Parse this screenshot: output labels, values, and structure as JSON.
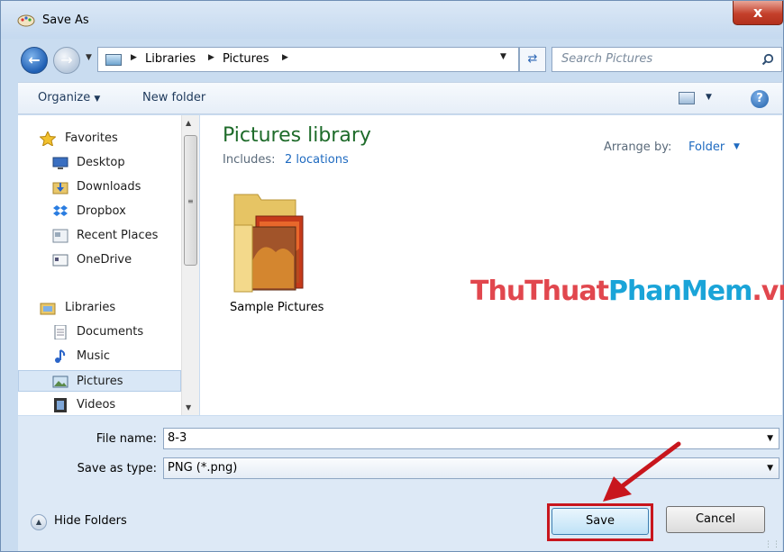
{
  "window": {
    "title": "Save As",
    "close_label": "x"
  },
  "address": {
    "crumbs": [
      "Libraries",
      "Pictures"
    ],
    "search_placeholder": "Search Pictures"
  },
  "toolbar": {
    "organize": "Organize",
    "new_folder": "New folder"
  },
  "nav": {
    "favorites_header": "Favorites",
    "favorites": [
      {
        "label": "Desktop",
        "icon": "desktop-icon"
      },
      {
        "label": "Downloads",
        "icon": "downloads-icon"
      },
      {
        "label": "Dropbox",
        "icon": "dropbox-icon"
      },
      {
        "label": "Recent Places",
        "icon": "recent-places-icon"
      },
      {
        "label": "OneDrive",
        "icon": "onedrive-icon"
      }
    ],
    "libraries_header": "Libraries",
    "libraries": [
      {
        "label": "Documents",
        "icon": "documents-icon"
      },
      {
        "label": "Music",
        "icon": "music-icon"
      },
      {
        "label": "Pictures",
        "icon": "pictures-icon",
        "selected": true
      },
      {
        "label": "Videos",
        "icon": "videos-icon"
      }
    ]
  },
  "content": {
    "library_title": "Pictures library",
    "includes_label": "Includes:",
    "locations_link": "2 locations",
    "arrange_label": "Arrange by:",
    "arrange_value": "Folder",
    "items": [
      {
        "label": "Sample Pictures",
        "icon": "folder-icon"
      }
    ],
    "watermark_a": "ThuThuat",
    "watermark_b": "PhanMem",
    "watermark_c": ".vn"
  },
  "form": {
    "file_name_label": "File name:",
    "file_name_value": "8-3",
    "save_type_label": "Save as type:",
    "save_type_value": "PNG (*.png)",
    "hide_folders": "Hide Folders",
    "save_button": "Save",
    "cancel_button": "Cancel"
  },
  "colors": {
    "accent_red": "#c8161d",
    "title_green": "#1e6b2a",
    "link_blue": "#1e6ac0"
  }
}
